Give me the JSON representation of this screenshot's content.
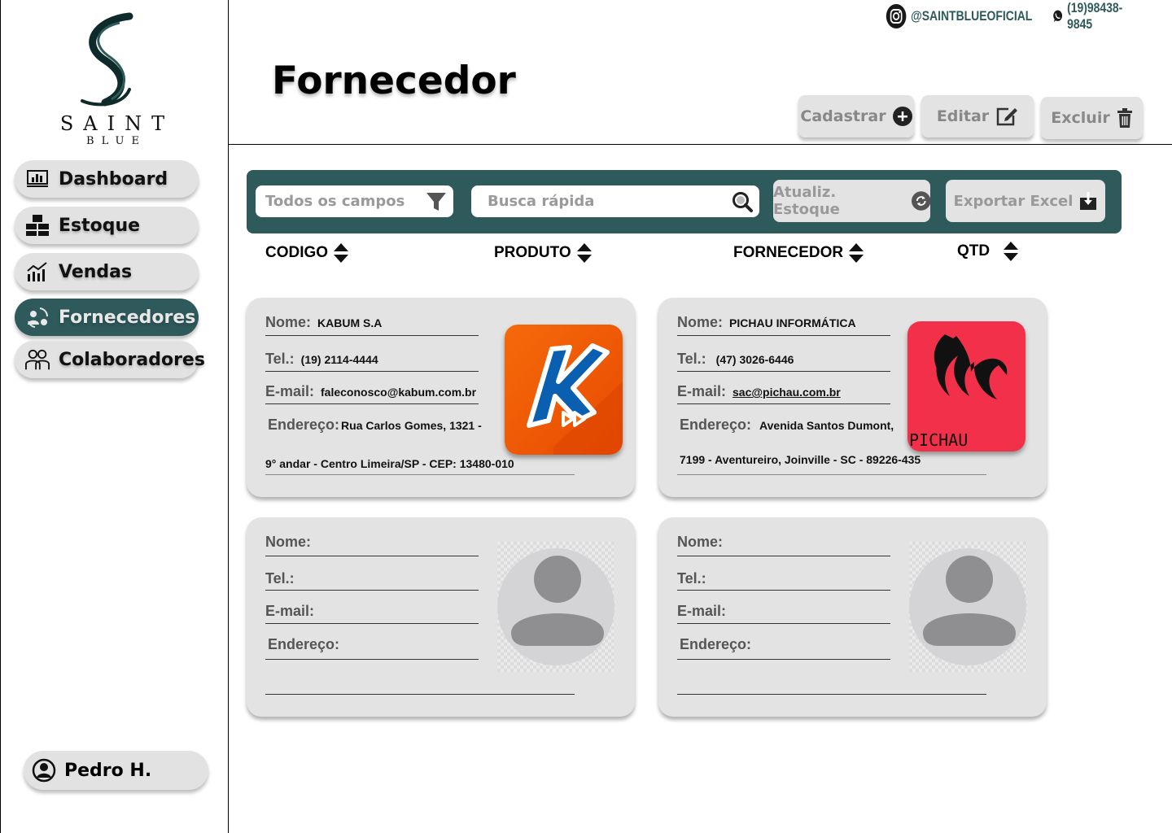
{
  "brand": {
    "name": "SAINT",
    "sub": "BLUE"
  },
  "topbar": {
    "instagram": "@SAINTBLUEOFICIAL",
    "whatsapp": "(19)98438-9845"
  },
  "page": {
    "title": "Fornecedor"
  },
  "actions": {
    "cadastrar": "Cadastrar",
    "editar": "Editar",
    "excluir": "Excluir"
  },
  "sidebar": {
    "items": [
      {
        "label": "Dashboard",
        "icon": "bar-chart-icon"
      },
      {
        "label": "Estoque",
        "icon": "boxes-icon"
      },
      {
        "label": "Vendas",
        "icon": "sales-chart-icon"
      },
      {
        "label": "Fornecedores",
        "icon": "supplier-exchange-icon",
        "active": true
      },
      {
        "label": "Colaboradores",
        "icon": "team-icon"
      }
    ],
    "user": "Pedro H."
  },
  "toolbar": {
    "filter_placeholder": "Todos os campos",
    "search_placeholder": "Busca rápida",
    "update_stock": "Atualiz. Estoque",
    "export_excel": "Exportar Excel"
  },
  "columns": [
    "CODIGO",
    "PRODUTO",
    "FORNECEDOR",
    "QTD"
  ],
  "labels": {
    "nome": "Nome:",
    "tel": "Tel.:",
    "email": "E-mail:",
    "endereco": "Endereço:"
  },
  "suppliers": [
    {
      "nome": "KABUM S.A",
      "tel": "(19) 2114-4444",
      "email": "faleconosco@kabum.com.br",
      "endereco_1": "Rua Carlos Gomes, 1321 -",
      "endereco_2": "9° andar - Centro Limeira/SP - CEP: 13480-010",
      "logo": "kabum-logo"
    },
    {
      "nome": "PICHAU INFORMÁTICA",
      "tel": "(47) 3026-6446",
      "email": "sac@pichau.com.br",
      "endereco_1": "Avenida Santos Dumont,",
      "endereco_2": "7199 - Aventureiro, Joinville - SC - 89226-435",
      "logo": "pichau-logo",
      "logo_text": "PICHAU"
    }
  ],
  "colors": {
    "accent": "#2e5a5c",
    "card": "#e3e3e3",
    "kabum": "#f25c05",
    "pichau": "#f2304a"
  }
}
